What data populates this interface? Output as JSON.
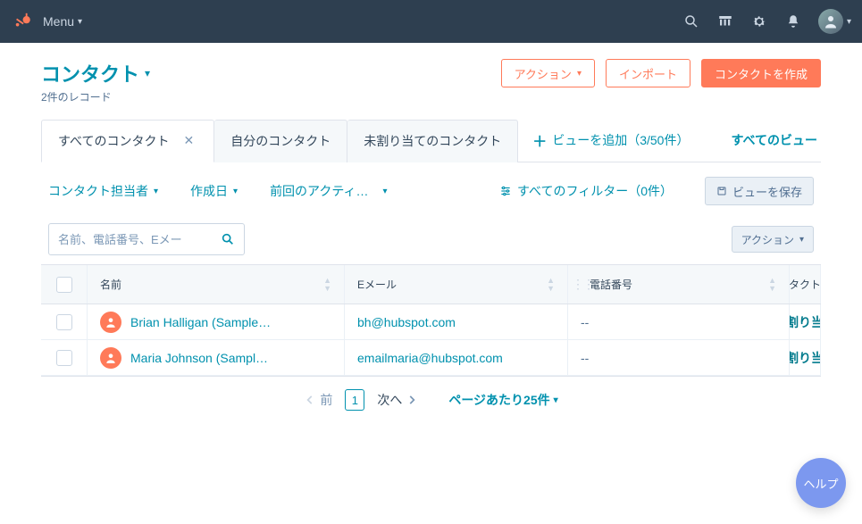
{
  "nav": {
    "menu_label": "Menu"
  },
  "header": {
    "title": "コンタクト",
    "record_count": "2件のレコード",
    "actions_label": "アクション",
    "import_label": "インポート",
    "create_label": "コンタクトを作成"
  },
  "tabs": {
    "items": [
      {
        "label": "すべてのコンタクト",
        "closable": true,
        "active": true
      },
      {
        "label": "自分のコンタクト",
        "closable": false,
        "active": false
      },
      {
        "label": "未割り当てのコンタクト",
        "closable": false,
        "active": false
      }
    ],
    "add_label": "ビューを追加（3/50件）",
    "all_views_label": "すべてのビュー"
  },
  "filters": {
    "items": [
      {
        "label": "コンタクト担当者"
      },
      {
        "label": "作成日"
      },
      {
        "label": "前回のアクティ…"
      }
    ],
    "all_filters_label": "すべてのフィルター（0件）",
    "save_view_label": "ビューを保存"
  },
  "toolbar": {
    "search_placeholder": "名前、電話番号、Eメー",
    "action_label": "アクション"
  },
  "table": {
    "columns": {
      "name": "名前",
      "email": "Eメール",
      "phone": "電話番号",
      "owner": "コンタクト担当"
    },
    "rows": [
      {
        "name": "Brian Halligan (Sample…",
        "email": "bh@hubspot.com",
        "phone": "--",
        "owner": "未割り当て"
      },
      {
        "name": "Maria Johnson (Sampl…",
        "email": "emailmaria@hubspot.com",
        "phone": "--",
        "owner": "未割り当て"
      }
    ]
  },
  "pager": {
    "prev": "前",
    "next": "次へ",
    "page": "1",
    "per_page": "ページあたり25件"
  },
  "help": {
    "label": "ヘルプ"
  }
}
